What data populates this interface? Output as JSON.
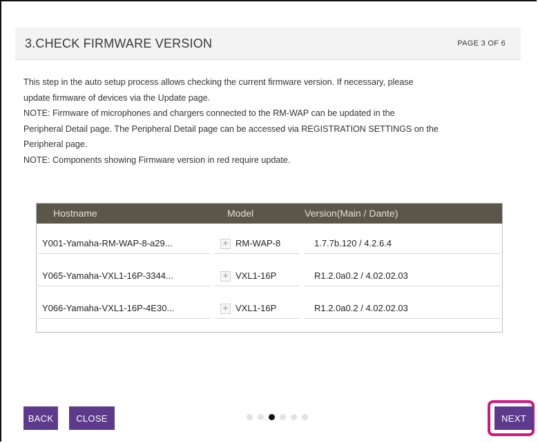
{
  "header": {
    "title": "3.CHECK FIRMWARE VERSION",
    "page_indicator": "PAGE 3 OF 6"
  },
  "description": {
    "line1": "This step in the auto setup process allows checking the current firmware version. If necessary, please",
    "line2": "update firmware of devices via the Update page.",
    "line3": "NOTE: Firmware of microphones and chargers connected to the RM-WAP can be updated in the",
    "line4": "Peripheral Detail page. The Peripheral Detail page can be accessed via REGISTRATION SETTINGS on the",
    "line5": "Peripheral page.",
    "line6": "NOTE: Components showing Firmware version in red require update."
  },
  "table": {
    "columns": [
      "Hostname",
      "Model",
      "Version(Main / Dante)"
    ],
    "rows": [
      {
        "hostname": "Y001-Yamaha-RM-WAP-8-a29...",
        "model": "RM-WAP-8",
        "version": "1.7.7b.120 / 4.2.6.4",
        "icon": "device-icon"
      },
      {
        "hostname": "Y065-Yamaha-VXL1-16P-3344...",
        "model": "VXL1-16P",
        "version": "R1.2.0a0.2 / 4.02.02.03",
        "icon": "device-icon"
      },
      {
        "hostname": "Y066-Yamaha-VXL1-16P-4E30...",
        "model": "VXL1-16P",
        "version": "R1.2.0a0.2 / 4.02.02.03",
        "icon": "device-icon"
      }
    ]
  },
  "footer": {
    "back_label": "BACK",
    "close_label": "CLOSE",
    "next_label": "NEXT",
    "total_pages": 6,
    "current_page": 3
  },
  "colors": {
    "button": "#5d3a8c",
    "table_header": "#5b564a",
    "highlight": "#d2157e"
  }
}
